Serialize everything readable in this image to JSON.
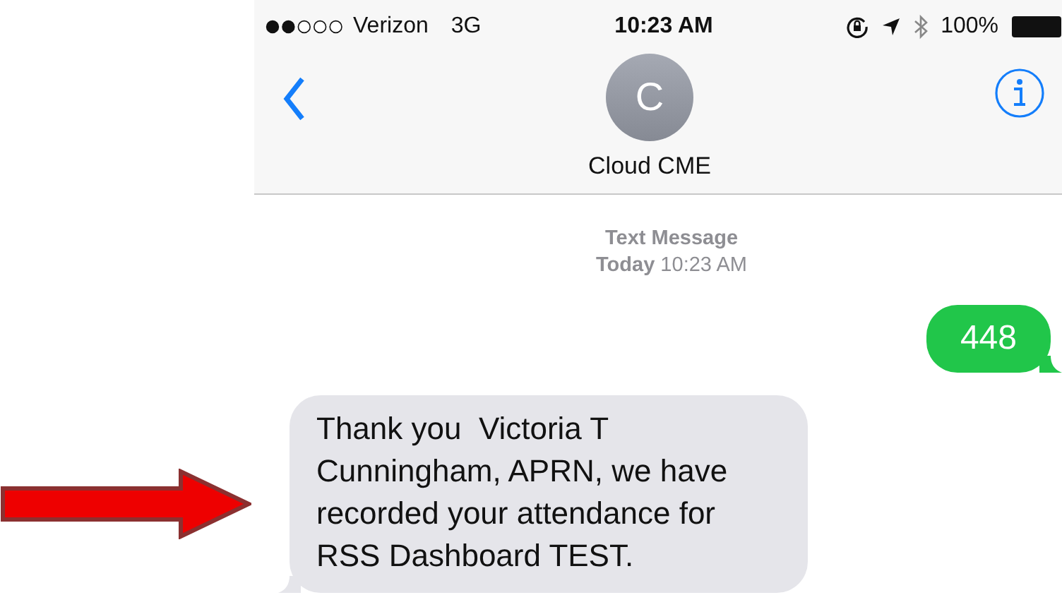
{
  "status_bar": {
    "carrier": "Verizon",
    "network": "3G",
    "time": "10:23 AM",
    "battery": "100%"
  },
  "header": {
    "avatar_initial": "C",
    "contact_name": "Cloud CME"
  },
  "timestamp": {
    "label": "Text Message",
    "time": "**Today** 10:23 AM"
  },
  "messages": [
    {
      "kind": "outgoing",
      "text": "448"
    },
    {
      "kind": "incoming",
      "text": "Thank you  Victoria T Cunningham, APRN, we have recorded your attendance for RSS Dashboard TEST."
    }
  ]
}
